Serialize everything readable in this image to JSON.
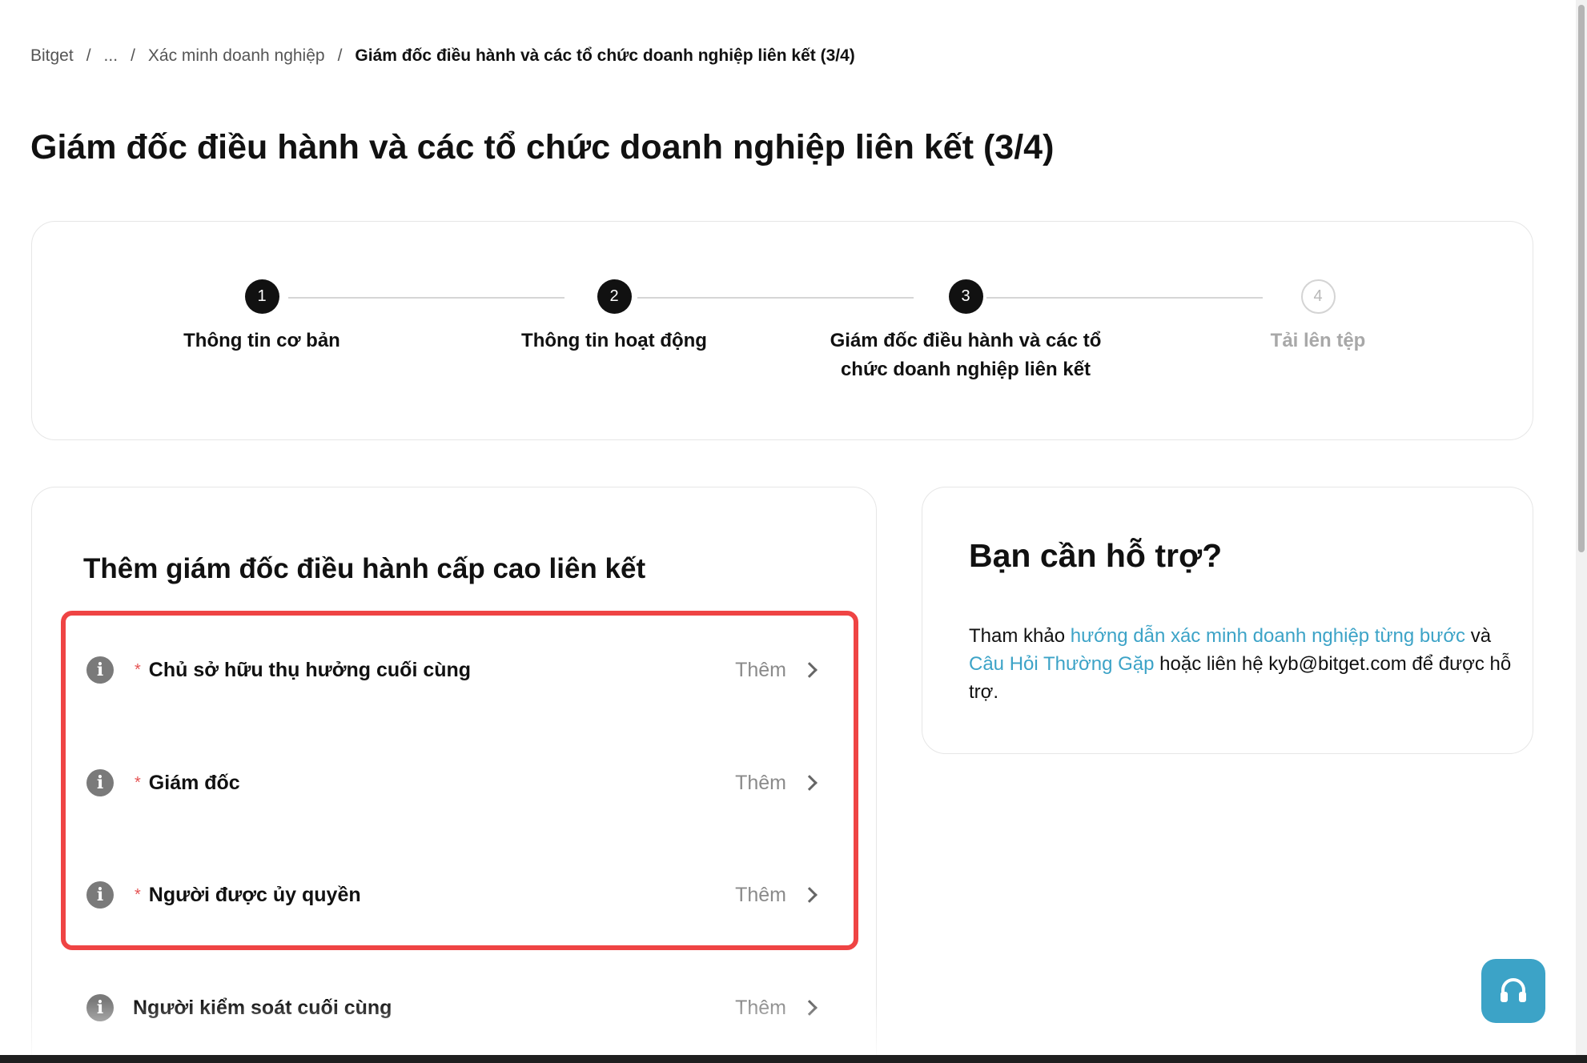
{
  "breadcrumb": {
    "items": [
      "Bitget",
      "...",
      "Xác minh doanh nghiệp"
    ],
    "current": "Giám đốc điều hành và các tổ chức doanh nghiệp liên kết (3/4)",
    "separator": "/"
  },
  "page_title": "Giám đốc điều hành và các tổ chức doanh nghiệp liên kết (3/4)",
  "stepper": {
    "steps": [
      {
        "number": "1",
        "label": "Thông tin cơ bản",
        "state": "done"
      },
      {
        "number": "2",
        "label": "Thông tin hoạt động",
        "state": "done"
      },
      {
        "number": "3",
        "label_line1": "Giám đốc điều hành và các tổ",
        "label_line2": "chức doanh nghiệp liên kết",
        "state": "current"
      },
      {
        "number": "4",
        "label": "Tải lên tệp",
        "state": "todo"
      }
    ]
  },
  "executives": {
    "title": "Thêm giám đốc điều hành cấp cao liên kết",
    "required_mark": "*",
    "info_icon": "i",
    "rows": [
      {
        "label": "Chủ sở hữu thụ hưởng cuối cùng",
        "action": "Thêm",
        "required": true
      },
      {
        "label": "Giám đốc",
        "action": "Thêm",
        "required": true
      },
      {
        "label": "Người được ủy quyền",
        "action": "Thêm",
        "required": true
      },
      {
        "label": "Người kiểm soát cuối cùng",
        "action": "Thêm",
        "required": false
      }
    ]
  },
  "help": {
    "title": "Bạn cần hỗ trợ?",
    "text_prefix": "Tham khảo ",
    "guide_link": "hướng dẫn xác minh doanh nghiệp từng bước",
    "text_and": " và ",
    "faq_link": "Câu Hỏi Thường Gặp",
    "text_suffix": " hoặc liên hệ kyb@bitget.com để được hỗ trợ."
  },
  "colors": {
    "accent": "#3ca3c7",
    "highlight": "#ef4444",
    "required": "#e55353"
  },
  "icons": {
    "support": "headset-icon",
    "info": "info-icon",
    "chevron": "chevron-right-icon"
  }
}
